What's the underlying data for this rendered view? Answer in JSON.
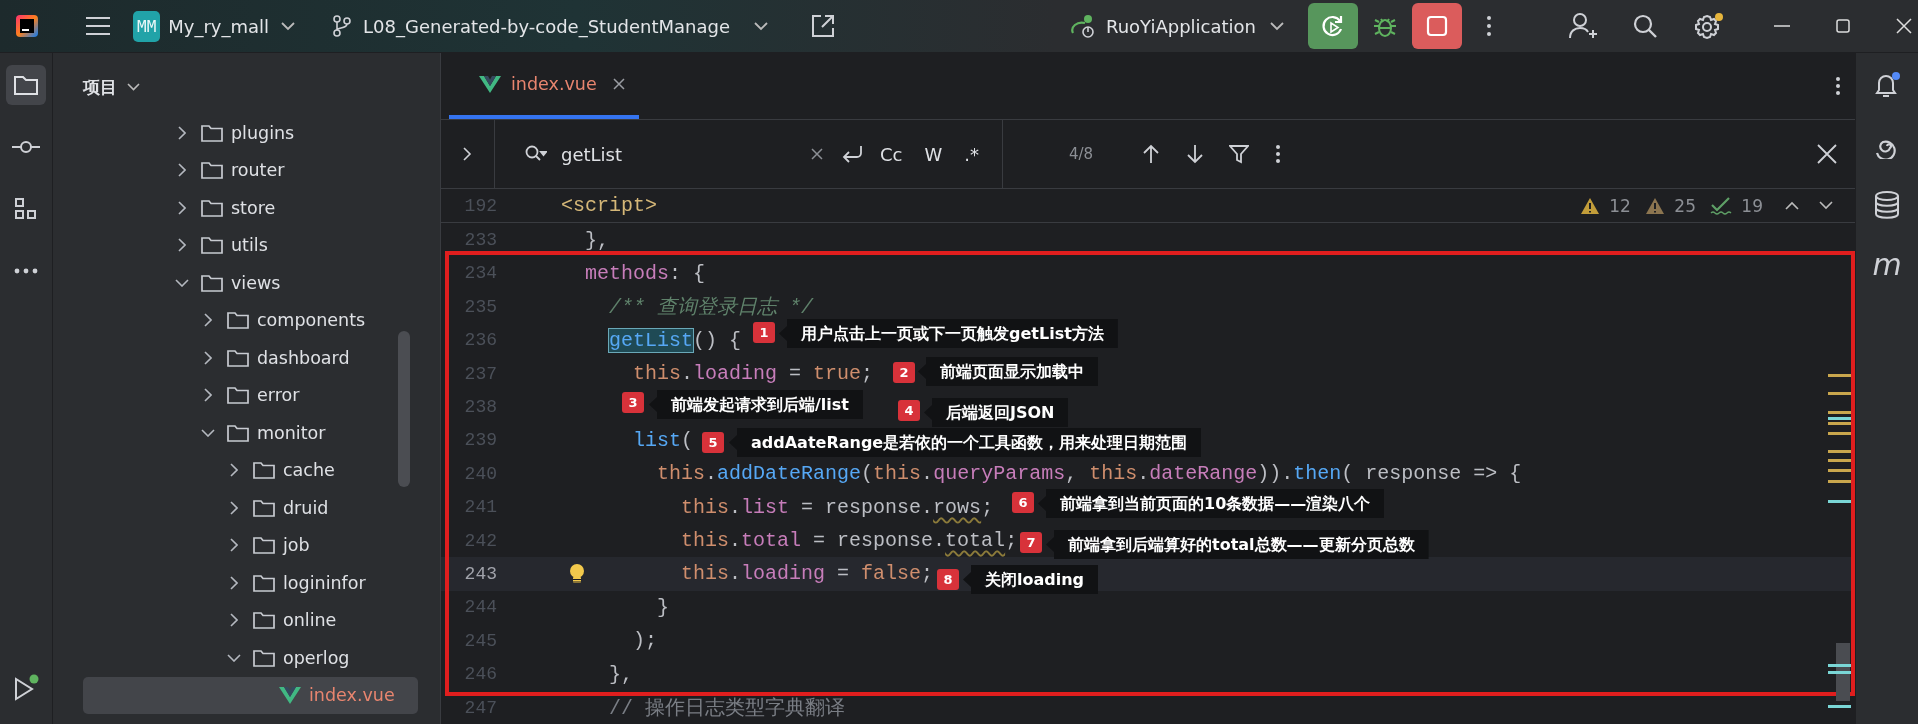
{
  "title_bar": {
    "project_badge": "MM",
    "project": "My_ry_mall",
    "branch": "L08_Generated-by-code_StudentManage",
    "run_config": "RuoYiApplication"
  },
  "tool_windows": [
    {
      "selected": true
    },
    {
      "selected": false
    },
    {
      "selected": false
    },
    {
      "selected": false
    }
  ],
  "project_panel": {
    "title": "项目",
    "tree": [
      {
        "name": "plugins",
        "kind": "folder",
        "expanded": false,
        "selected": false
      },
      {
        "name": "router",
        "kind": "folder",
        "expanded": false,
        "selected": false
      },
      {
        "name": "store",
        "kind": "folder",
        "expanded": false,
        "selected": false
      },
      {
        "name": "utils",
        "kind": "folder",
        "expanded": false,
        "selected": false
      },
      {
        "name": "views",
        "kind": "folder",
        "expanded": true,
        "selected": false,
        "children": [
          {
            "name": "components",
            "kind": "folder",
            "expanded": false,
            "selected": false
          },
          {
            "name": "dashboard",
            "kind": "folder",
            "expanded": false,
            "selected": false
          },
          {
            "name": "error",
            "kind": "folder",
            "expanded": false,
            "selected": false
          },
          {
            "name": "monitor",
            "kind": "folder",
            "expanded": true,
            "selected": false,
            "children": [
              {
                "name": "cache",
                "kind": "folder",
                "expanded": false,
                "selected": false
              },
              {
                "name": "druid",
                "kind": "folder",
                "expanded": false,
                "selected": false
              },
              {
                "name": "job",
                "kind": "folder",
                "expanded": false,
                "selected": false
              },
              {
                "name": "logininfor",
                "kind": "folder",
                "expanded": false,
                "selected": false
              },
              {
                "name": "online",
                "kind": "folder",
                "expanded": false,
                "selected": false
              },
              {
                "name": "operlog",
                "kind": "folder",
                "expanded": true,
                "selected": false,
                "children": [
                  {
                    "name": "index.vue",
                    "kind": "vue-file",
                    "selected": true
                  }
                ]
              }
            ]
          }
        ]
      }
    ]
  },
  "editor": {
    "tabs": [
      {
        "label": "index.vue",
        "selected": true
      }
    ],
    "search": {
      "value": "getList",
      "options": [
        "Cc",
        "W",
        ".*"
      ],
      "match_count": "4/8"
    },
    "inspections": [
      {
        "kind": "warning",
        "count": "12"
      },
      {
        "kind": "weak-warning",
        "count": "25"
      },
      {
        "kind": "typo",
        "count": "19"
      }
    ],
    "lines": [
      {
        "number": "192",
        "current": false,
        "tokens": [
          {
            "kind": "tag",
            "text": "<script>"
          }
        ]
      },
      {
        "number": "233",
        "current": false,
        "tokens": [
          {
            "kind": "plain",
            "text": "  },"
          }
        ]
      },
      {
        "number": "234",
        "current": false,
        "tokens": [
          {
            "kind": "prop",
            "text": "  methods"
          },
          {
            "kind": "plain",
            "text": ": {"
          }
        ]
      },
      {
        "number": "235",
        "current": false,
        "tokens": [
          {
            "kind": "doc",
            "text": "    /** 查询登录日志 */"
          }
        ]
      },
      {
        "number": "236",
        "current": false,
        "tokens": [
          {
            "kind": "match",
            "text": "    getList"
          },
          {
            "kind": "plain",
            "text": "() {"
          }
        ]
      },
      {
        "number": "237",
        "current": false,
        "tokens": [
          {
            "kind": "this",
            "text": "      this"
          },
          {
            "kind": "plain",
            "text": "."
          },
          {
            "kind": "prop",
            "text": "loading"
          },
          {
            "kind": "plain",
            "text": " = "
          },
          {
            "kind": "literal",
            "text": "true"
          },
          {
            "kind": "plain",
            "text": ";"
          }
        ]
      },
      {
        "number": "238",
        "current": false
      },
      {
        "number": "239",
        "current": false,
        "tokens": [
          {
            "kind": "method",
            "text": "      list"
          },
          {
            "kind": "plain",
            "text": "("
          }
        ]
      },
      {
        "number": "240",
        "current": false,
        "tokens": [
          {
            "kind": "this",
            "text": "        this"
          },
          {
            "kind": "plain",
            "text": "."
          },
          {
            "kind": "method",
            "text": "addDateRange"
          },
          {
            "kind": "plain",
            "text": "("
          },
          {
            "kind": "this",
            "text": "this"
          },
          {
            "kind": "plain",
            "text": "."
          },
          {
            "kind": "prop",
            "text": "queryParams"
          },
          {
            "kind": "plain",
            "text": ", "
          },
          {
            "kind": "this",
            "text": "this"
          },
          {
            "kind": "plain",
            "text": "."
          },
          {
            "kind": "prop",
            "text": "dateRange"
          },
          {
            "kind": "plain",
            "text": "))."
          },
          {
            "kind": "method",
            "text": "then"
          },
          {
            "kind": "plain",
            "text": "( response => {"
          }
        ]
      },
      {
        "number": "241",
        "current": false,
        "tokens": [
          {
            "kind": "this",
            "text": "          this"
          },
          {
            "kind": "plain",
            "text": "."
          },
          {
            "kind": "prop",
            "text": "list"
          },
          {
            "kind": "plain",
            "text": " = response."
          },
          {
            "kind": "typo",
            "text": "rows"
          },
          {
            "kind": "plain",
            "text": ";"
          }
        ]
      },
      {
        "number": "242",
        "current": false,
        "tokens": [
          {
            "kind": "this",
            "text": "          this"
          },
          {
            "kind": "plain",
            "text": "."
          },
          {
            "kind": "prop",
            "text": "total"
          },
          {
            "kind": "plain",
            "text": " = response."
          },
          {
            "kind": "typo",
            "text": "total"
          },
          {
            "kind": "plain",
            "text": ";"
          }
        ]
      },
      {
        "number": "243",
        "current": true,
        "tokens": [
          {
            "kind": "this",
            "text": "          this"
          },
          {
            "kind": "plain",
            "text": "."
          },
          {
            "kind": "prop",
            "text": "loading"
          },
          {
            "kind": "plain",
            "text": " = "
          },
          {
            "kind": "literal",
            "text": "false"
          },
          {
            "kind": "plain",
            "text": ";"
          }
        ]
      },
      {
        "number": "244",
        "current": false,
        "tokens": [
          {
            "kind": "plain",
            "text": "        }"
          }
        ]
      },
      {
        "number": "245",
        "current": false,
        "tokens": [
          {
            "kind": "plain",
            "text": "      );"
          }
        ]
      },
      {
        "number": "246",
        "current": false,
        "tokens": [
          {
            "kind": "plain",
            "text": "    },"
          }
        ]
      },
      {
        "number": "247",
        "current": false,
        "tokens": [
          {
            "kind": "comment",
            "text": "    // 操作日志类型字典翻译"
          }
        ]
      }
    ],
    "annotations": [
      {
        "number": "1",
        "text": "用户点击上一页或下一页触发getList方法"
      },
      {
        "number": "2",
        "text": "前端页面显示加载中"
      },
      {
        "number": "3",
        "text": "前端发起请求到后端/list"
      },
      {
        "number": "4",
        "text": "后端返回JSON"
      },
      {
        "number": "5",
        "text": "addAateRange是若依的一个工具函数，用来处理日期范围"
      },
      {
        "number": "6",
        "text": "前端拿到当前页面的10条数据——渲染八个"
      },
      {
        "number": "7",
        "text": "前端拿到后端算好的total总数——更新分页总数"
      },
      {
        "number": "8",
        "text": "关闭loading"
      }
    ]
  },
  "right_toolbar": {
    "plugin_glyph": "m"
  }
}
